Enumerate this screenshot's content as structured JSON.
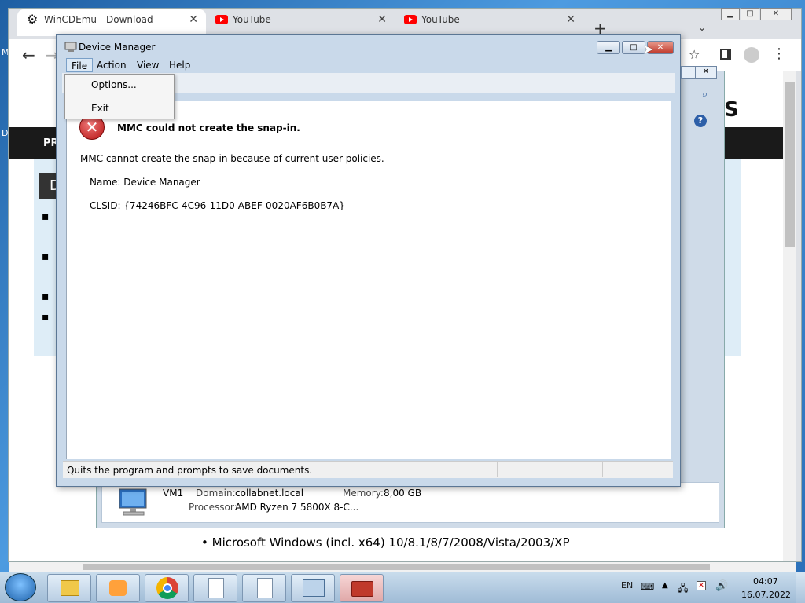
{
  "browser": {
    "tabs": [
      {
        "title": "WinCDEmu - Download",
        "icon": "gear-icon"
      },
      {
        "title": "YouTube",
        "icon": "youtube-icon"
      },
      {
        "title": "YouTube",
        "icon": "youtube-icon"
      }
    ],
    "new_tab": "+"
  },
  "page": {
    "nav_text": "PR",
    "heading_letter": "D",
    "logo_fragment": "S",
    "system_panel": {
      "name": "VM1",
      "domain_label": "Domain:",
      "domain_value": "collabnet.local",
      "memory_label": "Memory:",
      "memory_value": "8,00 GB",
      "processor_label": "Processor:",
      "processor_value": "AMD Ryzen 7 5800X 8-C..."
    },
    "os_bullet": "Microsoft Windows (incl. x64) 10/8.1/8/7/2008/Vista/2003/XP"
  },
  "device_manager": {
    "title": "Device Manager",
    "menu": {
      "file": "File",
      "action": "Action",
      "view": "View",
      "help": "Help"
    },
    "file_menu": {
      "options": "Options...",
      "exit": "Exit"
    },
    "error": {
      "heading": "MMC could not create the snap-in.",
      "message": "MMC cannot create the snap-in because of current user policies.",
      "name_line": "Name: Device Manager",
      "clsid_line": "CLSID: {74246BFC-4C96-11D0-ABEF-0020AF6B0B7A}"
    },
    "status": "Quits the program and prompts to save documents."
  },
  "taskbar": {
    "lang": "EN",
    "time": "04:07",
    "date": "16.07.2022"
  },
  "desktop": {
    "left_letter_1": "M",
    "left_letter_2": "D"
  }
}
